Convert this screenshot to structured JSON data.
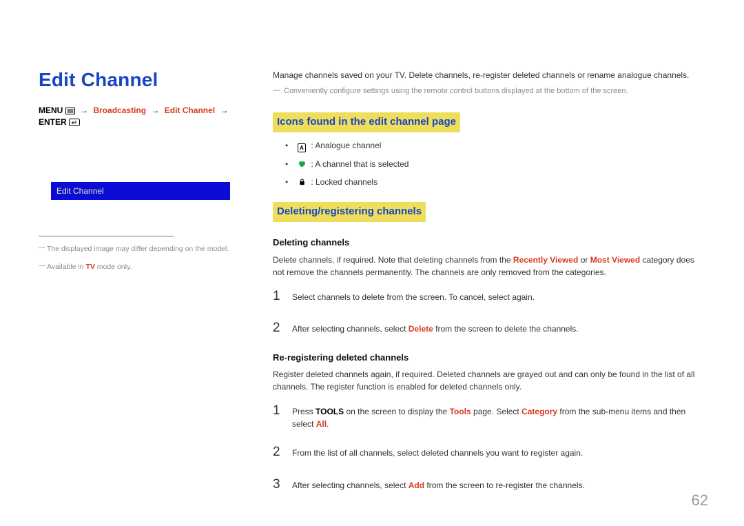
{
  "left": {
    "title": "Edit Channel",
    "breadcrumb": {
      "menu": "MENU",
      "seg1": "Broadcasting",
      "seg2": "Edit Channel",
      "enter": "ENTER"
    },
    "tv_bar_label": "Edit Channel",
    "footnote1": "The displayed image may differ depending on the model.",
    "footnote2_pre": "Available in ",
    "footnote2_tv": "TV",
    "footnote2_post": " mode only."
  },
  "right": {
    "intro": "Manage channels saved on your TV. Delete channels, re-register deleted channels or rename analogue channels.",
    "intro_note": "Conveniently configure settings using the remote control buttons displayed at the bottom of the screen.",
    "section_icons": {
      "heading": "Icons found in the edit channel page",
      "items": {
        "a_label": "A",
        "a_text": " : Analogue channel",
        "heart_text": " : A channel that is selected",
        "lock_text": " : Locked channels"
      }
    },
    "section_delreg": {
      "heading": "Deleting/registering channels",
      "deleting": {
        "subhead": "Deleting channels",
        "body_pre": "Delete channels, if required. Note that deleting channels from the ",
        "rv": "Recently Viewed",
        "body_mid": " or ",
        "mv": "Most Viewed",
        "body_post": " category does not remove the channels permanently. The channels are only removed from the categories.",
        "step1": "Select channels to delete from the screen. To cancel, select again.",
        "step2_pre": "After selecting channels, select ",
        "step2_kw": "Delete",
        "step2_post": " from the screen to delete the channels."
      },
      "rereg": {
        "subhead": "Re-registering deleted channels",
        "body": "Register deleted channels again, if required. Deleted channels are grayed out and can only be found in the list of all channels. The register function is enabled for deleted channels only.",
        "step1_pre": "Press ",
        "step1_kw1": "TOOLS",
        "step1_mid1": " on the screen to display the ",
        "step1_kw2": "Tools",
        "step1_mid2": " page. Select ",
        "step1_kw3": "Category",
        "step1_mid3": " from the sub-menu items and then select ",
        "step1_kw4": "All",
        "step1_post": ".",
        "step2": "From the list of all channels, select deleted channels you want to register again.",
        "step3_pre": "After selecting channels, select ",
        "step3_kw": "Add",
        "step3_post": " from the screen to re-register the channels."
      }
    }
  },
  "page_number": "62"
}
